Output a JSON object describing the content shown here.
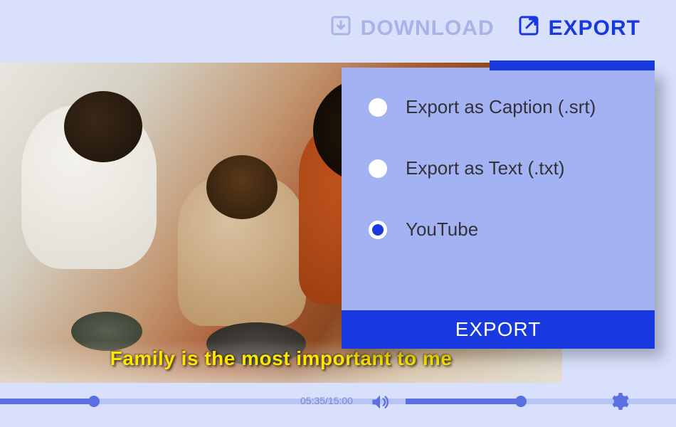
{
  "topActions": {
    "download": "DOWNLOAD",
    "export": "EXPORT"
  },
  "caption": "Family is the most important to me",
  "exportPanel": {
    "options": [
      {
        "label": "Export as Caption (.srt)",
        "selected": false
      },
      {
        "label": "Export as  Text (.txt)",
        "selected": false
      },
      {
        "label": "YouTube",
        "selected": true
      }
    ],
    "button": "EXPORT"
  },
  "player": {
    "time": "05:35/15:00"
  }
}
